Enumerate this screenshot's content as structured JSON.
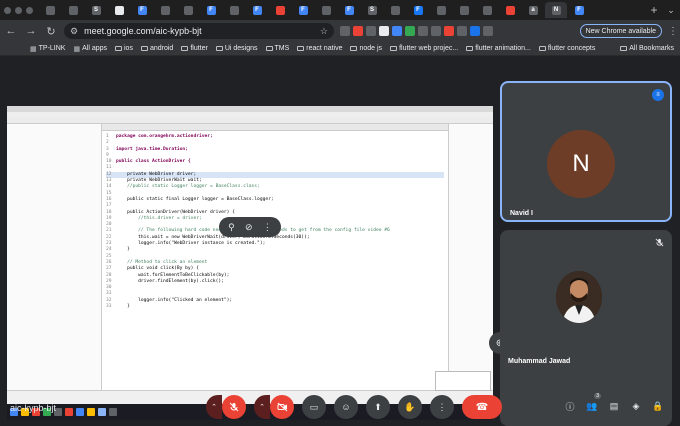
{
  "browser": {
    "tabs": [
      {
        "letter": "",
        "color": "#5f6368"
      },
      {
        "letter": "",
        "color": "#5f6368"
      },
      {
        "letter": "S",
        "color": "#5f6368"
      },
      {
        "letter": "",
        "color": "#e8eaed"
      },
      {
        "letter": "F",
        "color": "#4285f4"
      },
      {
        "letter": "",
        "color": "#5f6368"
      },
      {
        "letter": "",
        "color": "#5f6368"
      },
      {
        "letter": "F",
        "color": "#4285f4"
      },
      {
        "letter": "",
        "color": "#5f6368"
      },
      {
        "letter": "F",
        "color": "#4285f4"
      },
      {
        "letter": "",
        "color": "#ea4335"
      },
      {
        "letter": "F",
        "color": "#4285f4"
      },
      {
        "letter": "",
        "color": "#5f6368"
      },
      {
        "letter": "F",
        "color": "#4285f4"
      },
      {
        "letter": "S",
        "color": "#5f6368"
      },
      {
        "letter": "",
        "color": "#5f6368"
      },
      {
        "letter": "F",
        "color": "#1877f2"
      },
      {
        "letter": "",
        "color": "#5f6368"
      },
      {
        "letter": "",
        "color": "#5f6368"
      },
      {
        "letter": "",
        "color": "#5f6368"
      },
      {
        "letter": "",
        "color": "#ea4335"
      },
      {
        "letter": "a",
        "color": "#5f6368"
      },
      {
        "letter": "N",
        "color": "#5f6368"
      },
      {
        "letter": "F",
        "color": "#4285f4"
      }
    ],
    "active_tab_index": 22,
    "url_host": "meet.google.com",
    "url_path": "/aic-kypb-bjt",
    "update_button": "New Chrome available",
    "bookmarks": [
      {
        "label": "TP-LINK",
        "icon": "tplink-icon"
      },
      {
        "label": "All apps",
        "icon": "apps-grid-icon"
      },
      {
        "label": "ios",
        "icon": "folder-icon"
      },
      {
        "label": "android",
        "icon": "folder-icon"
      },
      {
        "label": "flutter",
        "icon": "folder-icon"
      },
      {
        "label": "Ui designs",
        "icon": "folder-icon"
      },
      {
        "label": "TMS",
        "icon": "folder-icon"
      },
      {
        "label": "react native",
        "icon": "folder-icon"
      },
      {
        "label": "node js",
        "icon": "folder-icon"
      },
      {
        "label": "flutter web projec...",
        "icon": "folder-icon"
      },
      {
        "label": "flutter animation...",
        "icon": "folder-icon"
      },
      {
        "label": "flutter concepts",
        "icon": "folder-icon"
      }
    ],
    "all_bookmarks": "All Bookmarks"
  },
  "presentation": {
    "code_lines": [
      {
        "n": "1",
        "t": "package com.orangehrm.actiondriver;",
        "c": "pkg"
      },
      {
        "n": "2",
        "t": "",
        "c": ""
      },
      {
        "n": "3",
        "t": "import java.time.Duration;",
        "c": "imp"
      },
      {
        "n": "9",
        "t": "",
        "c": ""
      },
      {
        "n": "10",
        "t": "public class ActionDriver {",
        "c": "cls"
      },
      {
        "n": "11",
        "t": "",
        "c": ""
      },
      {
        "n": "12",
        "t": "    private WebDriver driver;",
        "c": "hl"
      },
      {
        "n": "13",
        "t": "    private WebDriverWait wait;",
        "c": ""
      },
      {
        "n": "14",
        "t": "    //public static Logger logger = BaseClass.class;",
        "c": "cm"
      },
      {
        "n": "15",
        "t": "",
        "c": ""
      },
      {
        "n": "16",
        "t": "    public static final Logger logger = BaseClass.logger;",
        "c": ""
      },
      {
        "n": "17",
        "t": "",
        "c": ""
      },
      {
        "n": "18",
        "t": "    public ActionDriver(WebDriver driver) {",
        "c": ""
      },
      {
        "n": "19",
        "t": "        //this.driver = driver;",
        "c": "cm"
      },
      {
        "n": "20",
        "t": "",
        "c": ""
      },
      {
        "n": "21",
        "t": "        // The following hard code needs to be fixed, it needs to get from the config file video #6",
        "c": "cm"
      },
      {
        "n": "22",
        "t": "        this.wait = new WebDriverWait(driver, Duration.ofSeconds(30));",
        "c": ""
      },
      {
        "n": "23",
        "t": "        logger.info(\"WebDriver instance is created.\");",
        "c": ""
      },
      {
        "n": "24",
        "t": "    }",
        "c": ""
      },
      {
        "n": "25",
        "t": "",
        "c": ""
      },
      {
        "n": "26",
        "t": "    // Method to click an element",
        "c": "cm"
      },
      {
        "n": "27",
        "t": "    public void click(By by) {",
        "c": ""
      },
      {
        "n": "28",
        "t": "        wait.forElementToBeClickable(by);",
        "c": ""
      },
      {
        "n": "29",
        "t": "        driver.findElement(by).click();",
        "c": ""
      },
      {
        "n": "30",
        "t": "",
        "c": ""
      },
      {
        "n": "31",
        "t": "",
        "c": ""
      },
      {
        "n": "32",
        "t": "        logger.info(\"Clicked an element\");",
        "c": ""
      },
      {
        "n": "33",
        "t": "    }",
        "c": ""
      }
    ]
  },
  "participants": [
    {
      "name": "Navid I",
      "initial": "N",
      "avatar_color": "#6d3d27",
      "speaking": true
    },
    {
      "name": "Muhammad Jawad",
      "muted": true
    }
  ],
  "meeting": {
    "code": "aic-kypb-bjt",
    "people_count": "3"
  }
}
